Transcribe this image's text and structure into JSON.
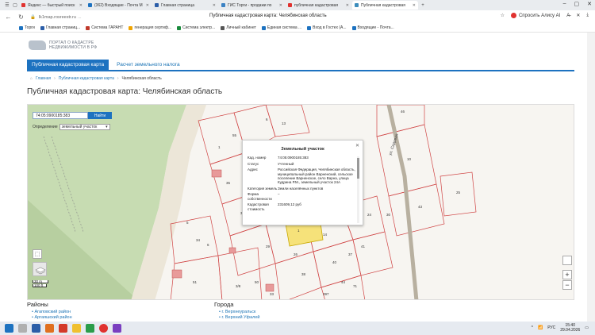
{
  "browser": {
    "tabs": [
      {
        "label": "Яндекс — быстрый поиск",
        "color": "#e0322f"
      },
      {
        "label": "(362) Входящие - Почта М",
        "color": "#1d72c0"
      },
      {
        "label": "Главная страница",
        "color": "#2b5ea8"
      },
      {
        "label": "ГИС Торги - продажи по",
        "color": "#3b82c4"
      },
      {
        "label": "публичная кадастровая",
        "color": "#e0322f"
      },
      {
        "label": "Публичная кадастровая",
        "color": "#3c8dbc"
      }
    ],
    "new_tab": "+",
    "url_path": "lk1map.rosreestr.ru",
    "url_domain": "...",
    "page_title": "Публичная кадастровая карта: Челябинская область",
    "alice_label": "Спросить Алису AI"
  },
  "bookmarks": [
    {
      "label": "Торги",
      "color": "#1d72c0"
    },
    {
      "label": "Главная страниц...",
      "color": "#2b5ea8"
    },
    {
      "label": "Система ГАРАНТ",
      "color": "#c0392b"
    },
    {
      "label": "генерация сертиф...",
      "color": "#f0a400"
    },
    {
      "label": "Система электр...",
      "color": "#1a8a3c"
    },
    {
      "label": "Личный кабинет",
      "color": "#555"
    },
    {
      "label": "Единая система ...",
      "color": "#1d72c0"
    },
    {
      "label": "Вход в Гостех (А...",
      "color": "#1d72c0"
    },
    {
      "label": "Входящие - Почта...",
      "color": "#1d72c0"
    }
  ],
  "site": {
    "logo_line1": "ПОРТАЛ О КАДАСТРЕ",
    "logo_line2": "НЕДВИЖИМОСТИ В РФ",
    "menu": [
      "Публичная кадастровая карта",
      "Расчет земельного налога"
    ],
    "crumbs": [
      "Главная",
      "Публичная кадастровая карта",
      "Челябинская область"
    ],
    "heading": "Публичная кадастровая карта: Челябинская область"
  },
  "map": {
    "search_value": "74:05:0900185:383",
    "search_button": "Найти",
    "determine_label": "Определение",
    "determine_select": "земельный участок",
    "scale_top": "30 m",
    "scale_bottom": "100 ft",
    "street_label": "ул. Садовая",
    "parcels": [
      "55",
      "35",
      "31",
      "34",
      "6",
      "51",
      "3/8",
      "29",
      "26",
      "38",
      "40",
      "37",
      "41",
      "42",
      "24",
      "30",
      "10",
      "43",
      "44",
      "71",
      "6",
      "25",
      "46",
      "13",
      "14",
      "1",
      "5",
      "50",
      "33",
      "397",
      "1"
    ],
    "zoom_in": "+",
    "zoom_out": "−"
  },
  "popup": {
    "title": "Земельный участок",
    "rows": [
      {
        "k": "Кад. номер",
        "v": "74:05:0900185:383"
      },
      {
        "k": "Статус",
        "v": "Учтенный"
      },
      {
        "k": "Адрес",
        "v": "Российская Федерация, Челябинская область, муниципальный район Варненский, сельское поселение Варненское, село Варна, улица Кудрина Р.М., земельный участок 24А"
      },
      {
        "k": "Категория земель",
        "v": "Земли населённых пунктов"
      },
      {
        "k": "Форма собственности",
        "v": "–"
      },
      {
        "k": "Кадастровая стоимость",
        "v": "231609,12 руб"
      }
    ]
  },
  "districts": {
    "title": "Районы",
    "items": [
      "Агаповский район",
      "Аргаяшский район"
    ]
  },
  "cities": {
    "title": "Города",
    "items": [
      "г. Верхнеуральск",
      "г. Верхний Уфалей"
    ]
  },
  "taskbar": {
    "lang": "РУС",
    "time": "15:40",
    "date": "29.04.2026"
  }
}
